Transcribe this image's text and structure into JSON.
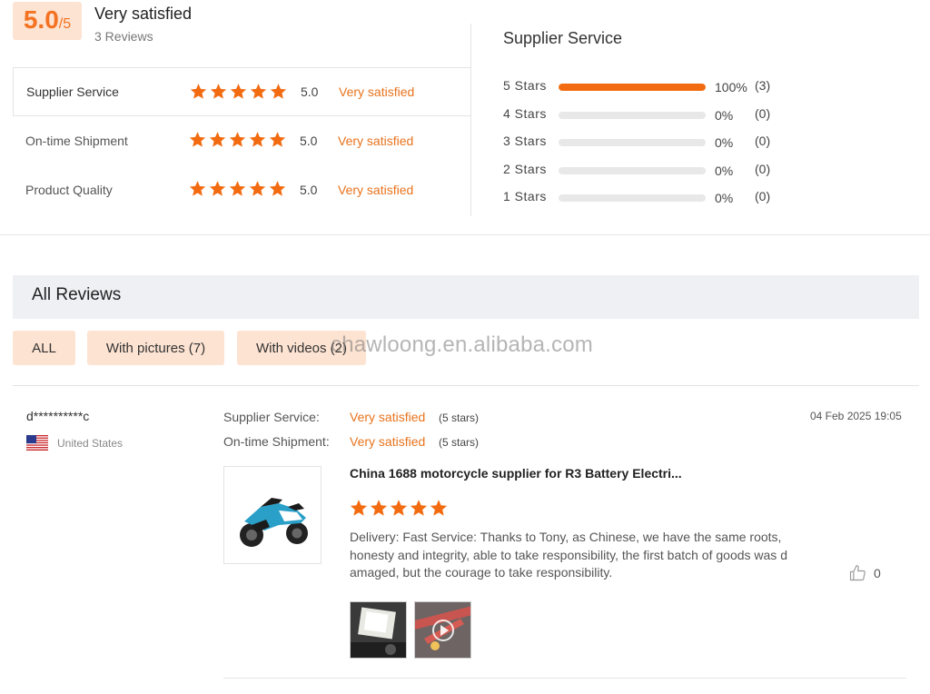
{
  "summary": {
    "score": "5.0",
    "score_max": "/5",
    "overall_label": "Very satisfied",
    "reviews_count": "3 Reviews"
  },
  "ratings": [
    {
      "label": "Supplier Service",
      "value": "5.0",
      "word": "Very satisfied",
      "stars": 5
    },
    {
      "label": "On-time Shipment",
      "value": "5.0",
      "word": "Very satisfied",
      "stars": 5
    },
    {
      "label": "Product Quality",
      "value": "5.0",
      "word": "Very satisfied",
      "stars": 5
    }
  ],
  "distribution": {
    "title": "Supplier Service",
    "rows": [
      {
        "label": "5  Stars",
        "percent": "100%",
        "count": "(3)",
        "fill": 1.0
      },
      {
        "label": "4  Stars",
        "percent": "0%",
        "count": "(0)",
        "fill": 0
      },
      {
        "label": "3  Stars",
        "percent": "0%",
        "count": "(0)",
        "fill": 0
      },
      {
        "label": "2  Stars",
        "percent": "0%",
        "count": "(0)",
        "fill": 0
      },
      {
        "label": "1  Stars",
        "percent": "0%",
        "count": "(0)",
        "fill": 0
      }
    ]
  },
  "all_reviews": {
    "title": "All Reviews",
    "filters": [
      {
        "label": "ALL"
      },
      {
        "label": "With pictures (7)"
      },
      {
        "label": "With videos (2)"
      }
    ],
    "watermark": "chawloong.en.alibaba.com"
  },
  "review": {
    "reviewer": "d**********c",
    "country": "United States",
    "date": "04 Feb 2025 19:05",
    "sub_ratings": [
      {
        "label": "Supplier Service:",
        "word": "Very satisfied",
        "stars_text": "(5 stars)"
      },
      {
        "label": "On-time Shipment:",
        "word": "Very satisfied",
        "stars_text": "(5 stars)"
      }
    ],
    "product_title": "China 1688 motorcycle supplier for R3 Battery Electri...",
    "stars": 5,
    "text": "Delivery:   Fast Service:   Thanks to Tony, as Chinese, we have the same roots, honesty and integrity, able to take responsibility, the first batch of goods was damaged, but the courage to take responsibility.",
    "likes": "0"
  },
  "colors": {
    "accent": "#f47221",
    "star": "#f26b10",
    "accent_bg": "#fde3d2"
  }
}
